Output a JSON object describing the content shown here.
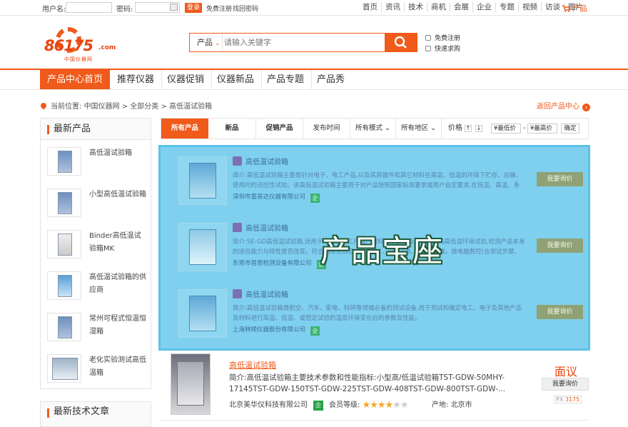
{
  "topbar": {
    "username_label": "用户名:",
    "password_label": "密码:",
    "login_btn": "登录",
    "register_link": "免费注册",
    "forgot_link": "找回密码",
    "nav": [
      "首页",
      "资讯",
      "技术",
      "商机",
      "会展",
      "企业",
      "专题",
      "视频",
      "访谈",
      "图片"
    ],
    "cart": "产品"
  },
  "logo": {
    "number": "86175",
    "com": ".com",
    "sub": "中国仪器网"
  },
  "search": {
    "category": "产品",
    "placeholder": "请输入关键字"
  },
  "header_links": {
    "register": "免费注册",
    "quick_buy": "快速求购"
  },
  "mainnav": [
    "产品中心首页",
    "推荐仪器",
    "仪器促销",
    "仪器新品",
    "产品专题",
    "产品秀"
  ],
  "breadcrumb": {
    "prefix": "当前位置:",
    "path": "中国仪器网 > 全部分类 > 高低温试验箱"
  },
  "back_link": "返回产品中心",
  "sidebar": {
    "title": "最新产品",
    "items": [
      {
        "label": "高低温试验箱"
      },
      {
        "label": "小型高低温试验箱"
      },
      {
        "label": "Binder高低温试验箱MK"
      },
      {
        "label": "高低温试验箱的供应商"
      },
      {
        "label": "常州可程式恒温恒湿箱"
      },
      {
        "label": "老化实验测试高低温箱"
      }
    ],
    "title2": "最新技术文章"
  },
  "filter": {
    "all": "所有产品",
    "new": "新品",
    "promo": "促销产品",
    "date": "发布时间",
    "mode": "所有模式",
    "region": "所有地区",
    "price": "价格",
    "low": "¥最低价",
    "dash": "-",
    "high": "¥最高价",
    "confirm": "确定"
  },
  "ad": {
    "overlay": "产品宝座",
    "rows": [
      {
        "title": "高低温试验箱",
        "desc": "简介:高低温试验箱主要是针对电子、电工产品,以及其原器件和其它材料在高温、低温的环境下贮存、运输、使用时的适应性试验。该高低温试验箱主要用于对产品按照国家标准要求或用户自定要求,在低温、高温、条件下,对产品的",
        "company": "深圳市富易达仪器有限公司",
        "qi": "企",
        "btn": "我要询价"
      },
      {
        "title": "高低温试验箱",
        "desc": "简介:SE-GD高低温试验箱,适用于电子、电工产品、材料、零部件及其他产品的高低温环境试验,检测产品本身的适应能力与特性是否改变。符合国际性规范之检测IEC、JIS、GB、MIL等标准。微电脑数控(含测试步骤、条件、方",
        "company": "东莞市首思检测设备有限公司",
        "qi": "企",
        "btn": "我要询价"
      },
      {
        "title": "高低温试验箱",
        "desc": "简介:高低温试验箱是航空、汽车、家电、科研等领域必备的测试设备,用于测试和确定电工、电子及其他产品及材料进行高温、低温、或恒定试验的温度环境变化后的参数及性能。",
        "company": "上海林频仪器股份有限公司",
        "qi": "企",
        "btn": "我要询价"
      }
    ]
  },
  "product": {
    "name": "高低温试验箱",
    "desc": "简介:高低温试验箱主要技术参数和性能指标:小型高/低温试验箱TST-GDW-50MHY-17145TST-GDW-150TST-GDW-225TST-GDW-408TST-GDW-800TST-GDW-...",
    "company": "北京美华仪科技有限公司",
    "qi": "企",
    "level_label": "会员等级:",
    "rating": 4,
    "rating_max": 6,
    "area_label": "产地:",
    "area": "北京市",
    "price": "面议",
    "ask_btn": "我要询价",
    "px_label": "PX",
    "px_value": "3175"
  },
  "colors": {
    "accent": "#f05a1a",
    "ad_bg": "#7fd0ee"
  }
}
